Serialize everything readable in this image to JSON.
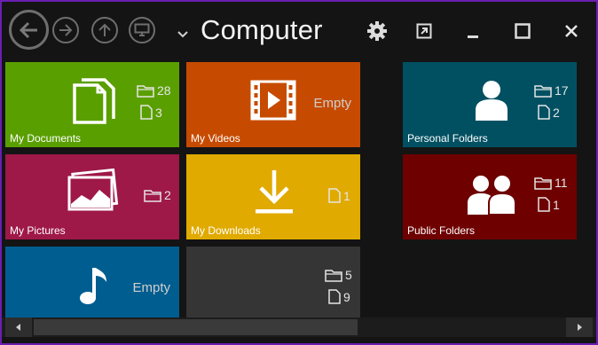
{
  "window": {
    "title": "Computer"
  },
  "toolbar": {
    "back_icon": "back-arrow-icon",
    "forward_icon": "forward-arrow-icon",
    "up_icon": "up-arrow-icon",
    "computer_icon": "monitor-icon",
    "settings_icon": "gear-icon",
    "popout_icon": "popout-icon",
    "minimize_icon": "minimize-icon",
    "maximize_icon": "maximize-icon",
    "close_icon": "close-icon"
  },
  "tiles": {
    "my_documents": {
      "label": "My Documents",
      "color": "#5a9f00",
      "folders": "28",
      "files": "3"
    },
    "my_videos": {
      "label": "My Videos",
      "color": "#c64b00",
      "status": "Empty"
    },
    "my_pictures": {
      "label": "My Pictures",
      "color": "#9e1848",
      "folders": "2"
    },
    "my_downloads": {
      "label": "My Downloads",
      "color": "#e0aa00",
      "files": "1"
    },
    "my_music": {
      "label": "",
      "color": "#005d8f",
      "status": "Empty"
    },
    "unnamed": {
      "label": "",
      "color": "#353535",
      "folders": "5",
      "files": "9"
    },
    "personal_folders": {
      "label": "Personal Folders",
      "color": "#005062",
      "folders": "17",
      "files": "2"
    },
    "public_folders": {
      "label": "Public Folders",
      "color": "#6e0000",
      "folders": "11",
      "files": "1"
    }
  }
}
